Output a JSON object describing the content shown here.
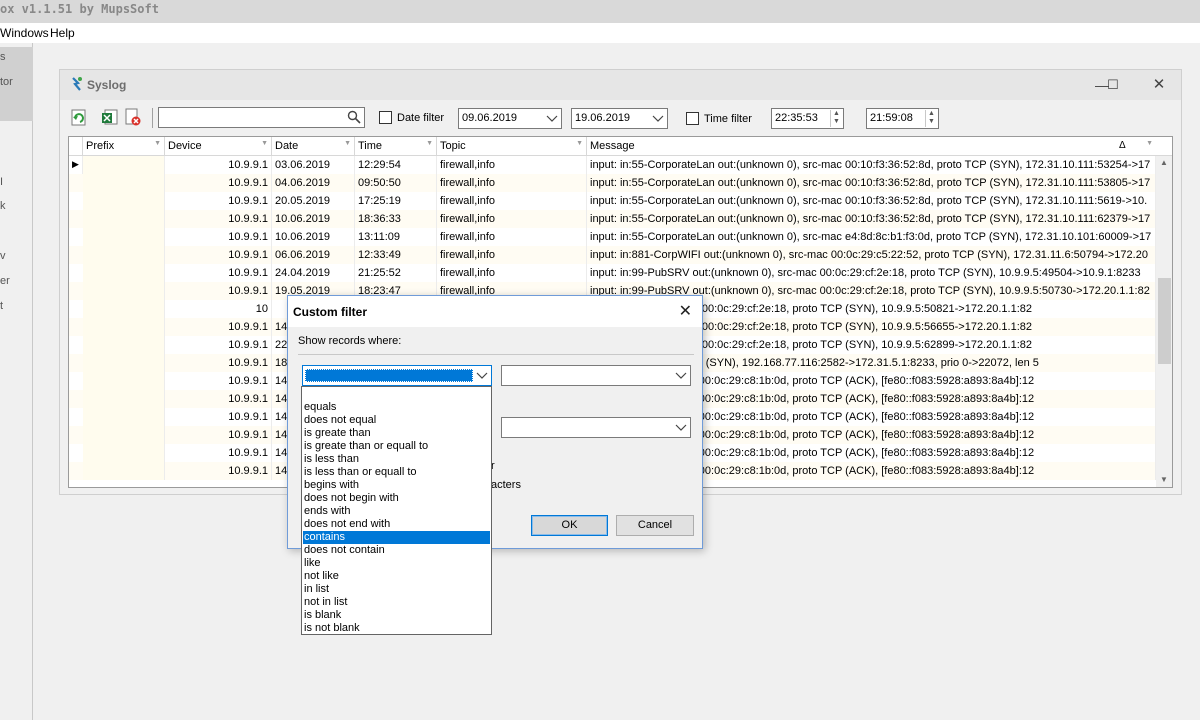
{
  "app": {
    "title": "ox v1.1.51  by MupsSoft"
  },
  "menubar": {
    "items": [
      "Windows",
      "Help"
    ]
  },
  "left_panel": {
    "fragments": [
      "s",
      "tor",
      "I",
      "k",
      "v",
      "er",
      "t"
    ]
  },
  "syslog_window": {
    "title": "Syslog",
    "min_glyph": "—",
    "max_glyph": "☐",
    "close_glyph": "✕"
  },
  "toolbar": {
    "search_value": "",
    "date_filter_label": "Date filter",
    "date_from": "09.06.2019",
    "date_to": "19.06.2019",
    "time_filter_label": "Time filter",
    "time_from": "22:35:53",
    "time_to": "21:59:08"
  },
  "grid": {
    "columns": [
      "Prefix",
      "Device",
      "Date",
      "Time",
      "Topic",
      "Message"
    ],
    "sort_indicator": "Δ",
    "rows": [
      {
        "device": "10.9.9.1",
        "date": "03.06.2019",
        "time": "12:29:54",
        "topic": "firewall,info",
        "message": "input: in:55-CorporateLan out:(unknown 0), src-mac 00:10:f3:36:52:8d, proto TCP (SYN), 172.31.10.111:53254->17"
      },
      {
        "device": "10.9.9.1",
        "date": "04.06.2019",
        "time": "09:50:50",
        "topic": "firewall,info",
        "message": "input: in:55-CorporateLan out:(unknown 0), src-mac 00:10:f3:36:52:8d, proto TCP (SYN), 172.31.10.111:53805->17"
      },
      {
        "device": "10.9.9.1",
        "date": "20.05.2019",
        "time": "17:25:19",
        "topic": "firewall,info",
        "message": "input: in:55-CorporateLan out:(unknown 0), src-mac 00:10:f3:36:52:8d, proto TCP (SYN), 172.31.10.111:5619->10."
      },
      {
        "device": "10.9.9.1",
        "date": "10.06.2019",
        "time": "18:36:33",
        "topic": "firewall,info",
        "message": "input: in:55-CorporateLan out:(unknown 0), src-mac 00:10:f3:36:52:8d, proto TCP (SYN), 172.31.10.111:62379->17"
      },
      {
        "device": "10.9.9.1",
        "date": "10.06.2019",
        "time": "13:11:09",
        "topic": "firewall,info",
        "message": "input: in:55-CorporateLan out:(unknown 0), src-mac e4:8d:8c:b1:f3:0d, proto TCP (SYN), 172.31.10.101:60009->17"
      },
      {
        "device": "10.9.9.1",
        "date": "06.06.2019",
        "time": "12:33:49",
        "topic": "firewall,info",
        "message": "input: in:881-CorpWIFI out:(unknown 0), src-mac 00:0c:29:c5:22:52, proto TCP (SYN), 172.31.11.6:50794->172.20"
      },
      {
        "device": "10.9.9.1",
        "date": "24.04.2019",
        "time": "21:25:52",
        "topic": "firewall,info",
        "message": "input: in:99-PubSRV out:(unknown 0), src-mac 00:0c:29:cf:2e:18, proto TCP (SYN), 10.9.9.5:49504->10.9.1:8233"
      },
      {
        "device": "10.9.9.1",
        "date": "19.05.2019",
        "time": "18:23:47",
        "topic": "firewall,info",
        "message": "input: in:99-PubSRV out:(unknown 0), src-mac 00:0c:29:cf:2e:18, proto TCP (SYN), 10.9.9.5:50730->172.20.1.1:82"
      },
      {
        "device": "10",
        "message": ":(unknown 0), src-mac 00:0c:29:cf:2e:18, proto TCP (SYN), 10.9.9.5:50821->172.20.1.1:82"
      },
      {
        "device": "10.9.9.1",
        "date": "14",
        "message": ":(unknown 0), src-mac 00:0c:29:cf:2e:18, proto TCP (SYN), 10.9.9.5:56655->172.20.1.1:82"
      },
      {
        "device": "10.9.9.1",
        "date": "22",
        "message": ":(unknown 0), src-mac 00:0c:29:cf:2e:18, proto TCP (SYN), 10.9.9.5:62899->172.20.1.1:82"
      },
      {
        "device": "10.9.9.1",
        "date": "18",
        "message": "unknown 0), proto TCP (SYN), 192.168.77.116:2582->172.31.5.1:8233, prio 0->22072, len 5"
      },
      {
        "device": "10.9.9.1",
        "date": "14",
        "message": "(unknown 0), src-mac 00:0c:29:c8:1b:0d, proto TCP (ACK), [fe80::f083:5928:a893:8a4b]:12"
      },
      {
        "device": "10.9.9.1",
        "date": "14",
        "message": "(unknown 0), src-mac 00:0c:29:c8:1b:0d, proto TCP (ACK), [fe80::f083:5928:a893:8a4b]:12"
      },
      {
        "device": "10.9.9.1",
        "date": "14",
        "message": "(unknown 0), src-mac 00:0c:29:c8:1b:0d, proto TCP (ACK), [fe80::f083:5928:a893:8a4b]:12"
      },
      {
        "device": "10.9.9.1",
        "date": "14",
        "message": "(unknown 0), src-mac 00:0c:29:c8:1b:0d, proto TCP (ACK), [fe80::f083:5928:a893:8a4b]:12"
      },
      {
        "device": "10.9.9.1",
        "date": "14",
        "message": "(unknown 0), src-mac 00:0c:29:c8:1b:0d, proto TCP (ACK), [fe80::f083:5928:a893:8a4b]:12"
      },
      {
        "device": "10.9.9.1",
        "date": "14",
        "message": "(unknown 0), src-mac 00:0c:29:c8:1b:0d, proto TCP (ACK), [fe80::f083:5928:a893:8a4b]:12"
      }
    ]
  },
  "dialog": {
    "title": "Custom filter",
    "close_glyph": "✕",
    "prompt": "Show records where:",
    "operator_value": "",
    "value_1": "",
    "value_2": "",
    "partial_text_1": "r",
    "partial_text_2": "acters",
    "ok_label": "OK",
    "cancel_label": "Cancel"
  },
  "operator_options": {
    "items": [
      "equals",
      "does not equal",
      "is greate than",
      "is greate than or equall to",
      "is less than",
      "is less than or equall to",
      "begins with",
      "does not begin with",
      "ends with",
      "does not end with",
      "contains",
      "does not contain",
      "like",
      "not like",
      "in list",
      "not in list",
      "is blank",
      "is not blank"
    ],
    "selected": "contains"
  },
  "colors": {
    "selection": "#0078d7",
    "alt_row": "#fffcf3",
    "focus_border": "#0078d7"
  }
}
